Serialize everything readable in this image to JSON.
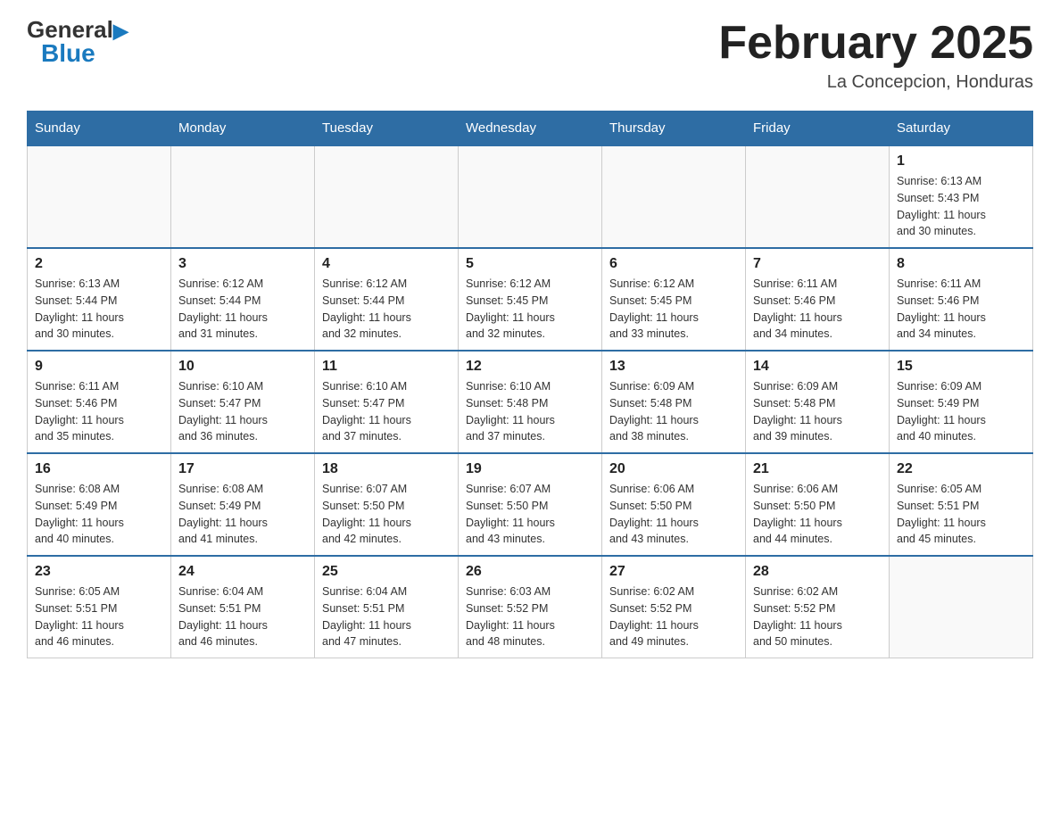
{
  "header": {
    "logo_general": "General",
    "logo_blue": "Blue",
    "month_title": "February 2025",
    "location": "La Concepcion, Honduras"
  },
  "days_of_week": [
    "Sunday",
    "Monday",
    "Tuesday",
    "Wednesday",
    "Thursday",
    "Friday",
    "Saturday"
  ],
  "weeks": [
    {
      "days": [
        {
          "num": "",
          "info": ""
        },
        {
          "num": "",
          "info": ""
        },
        {
          "num": "",
          "info": ""
        },
        {
          "num": "",
          "info": ""
        },
        {
          "num": "",
          "info": ""
        },
        {
          "num": "",
          "info": ""
        },
        {
          "num": "1",
          "info": "Sunrise: 6:13 AM\nSunset: 5:43 PM\nDaylight: 11 hours\nand 30 minutes."
        }
      ]
    },
    {
      "days": [
        {
          "num": "2",
          "info": "Sunrise: 6:13 AM\nSunset: 5:44 PM\nDaylight: 11 hours\nand 30 minutes."
        },
        {
          "num": "3",
          "info": "Sunrise: 6:12 AM\nSunset: 5:44 PM\nDaylight: 11 hours\nand 31 minutes."
        },
        {
          "num": "4",
          "info": "Sunrise: 6:12 AM\nSunset: 5:44 PM\nDaylight: 11 hours\nand 32 minutes."
        },
        {
          "num": "5",
          "info": "Sunrise: 6:12 AM\nSunset: 5:45 PM\nDaylight: 11 hours\nand 32 minutes."
        },
        {
          "num": "6",
          "info": "Sunrise: 6:12 AM\nSunset: 5:45 PM\nDaylight: 11 hours\nand 33 minutes."
        },
        {
          "num": "7",
          "info": "Sunrise: 6:11 AM\nSunset: 5:46 PM\nDaylight: 11 hours\nand 34 minutes."
        },
        {
          "num": "8",
          "info": "Sunrise: 6:11 AM\nSunset: 5:46 PM\nDaylight: 11 hours\nand 34 minutes."
        }
      ]
    },
    {
      "days": [
        {
          "num": "9",
          "info": "Sunrise: 6:11 AM\nSunset: 5:46 PM\nDaylight: 11 hours\nand 35 minutes."
        },
        {
          "num": "10",
          "info": "Sunrise: 6:10 AM\nSunset: 5:47 PM\nDaylight: 11 hours\nand 36 minutes."
        },
        {
          "num": "11",
          "info": "Sunrise: 6:10 AM\nSunset: 5:47 PM\nDaylight: 11 hours\nand 37 minutes."
        },
        {
          "num": "12",
          "info": "Sunrise: 6:10 AM\nSunset: 5:48 PM\nDaylight: 11 hours\nand 37 minutes."
        },
        {
          "num": "13",
          "info": "Sunrise: 6:09 AM\nSunset: 5:48 PM\nDaylight: 11 hours\nand 38 minutes."
        },
        {
          "num": "14",
          "info": "Sunrise: 6:09 AM\nSunset: 5:48 PM\nDaylight: 11 hours\nand 39 minutes."
        },
        {
          "num": "15",
          "info": "Sunrise: 6:09 AM\nSunset: 5:49 PM\nDaylight: 11 hours\nand 40 minutes."
        }
      ]
    },
    {
      "days": [
        {
          "num": "16",
          "info": "Sunrise: 6:08 AM\nSunset: 5:49 PM\nDaylight: 11 hours\nand 40 minutes."
        },
        {
          "num": "17",
          "info": "Sunrise: 6:08 AM\nSunset: 5:49 PM\nDaylight: 11 hours\nand 41 minutes."
        },
        {
          "num": "18",
          "info": "Sunrise: 6:07 AM\nSunset: 5:50 PM\nDaylight: 11 hours\nand 42 minutes."
        },
        {
          "num": "19",
          "info": "Sunrise: 6:07 AM\nSunset: 5:50 PM\nDaylight: 11 hours\nand 43 minutes."
        },
        {
          "num": "20",
          "info": "Sunrise: 6:06 AM\nSunset: 5:50 PM\nDaylight: 11 hours\nand 43 minutes."
        },
        {
          "num": "21",
          "info": "Sunrise: 6:06 AM\nSunset: 5:50 PM\nDaylight: 11 hours\nand 44 minutes."
        },
        {
          "num": "22",
          "info": "Sunrise: 6:05 AM\nSunset: 5:51 PM\nDaylight: 11 hours\nand 45 minutes."
        }
      ]
    },
    {
      "days": [
        {
          "num": "23",
          "info": "Sunrise: 6:05 AM\nSunset: 5:51 PM\nDaylight: 11 hours\nand 46 minutes."
        },
        {
          "num": "24",
          "info": "Sunrise: 6:04 AM\nSunset: 5:51 PM\nDaylight: 11 hours\nand 46 minutes."
        },
        {
          "num": "25",
          "info": "Sunrise: 6:04 AM\nSunset: 5:51 PM\nDaylight: 11 hours\nand 47 minutes."
        },
        {
          "num": "26",
          "info": "Sunrise: 6:03 AM\nSunset: 5:52 PM\nDaylight: 11 hours\nand 48 minutes."
        },
        {
          "num": "27",
          "info": "Sunrise: 6:02 AM\nSunset: 5:52 PM\nDaylight: 11 hours\nand 49 minutes."
        },
        {
          "num": "28",
          "info": "Sunrise: 6:02 AM\nSunset: 5:52 PM\nDaylight: 11 hours\nand 50 minutes."
        },
        {
          "num": "",
          "info": ""
        }
      ]
    }
  ]
}
